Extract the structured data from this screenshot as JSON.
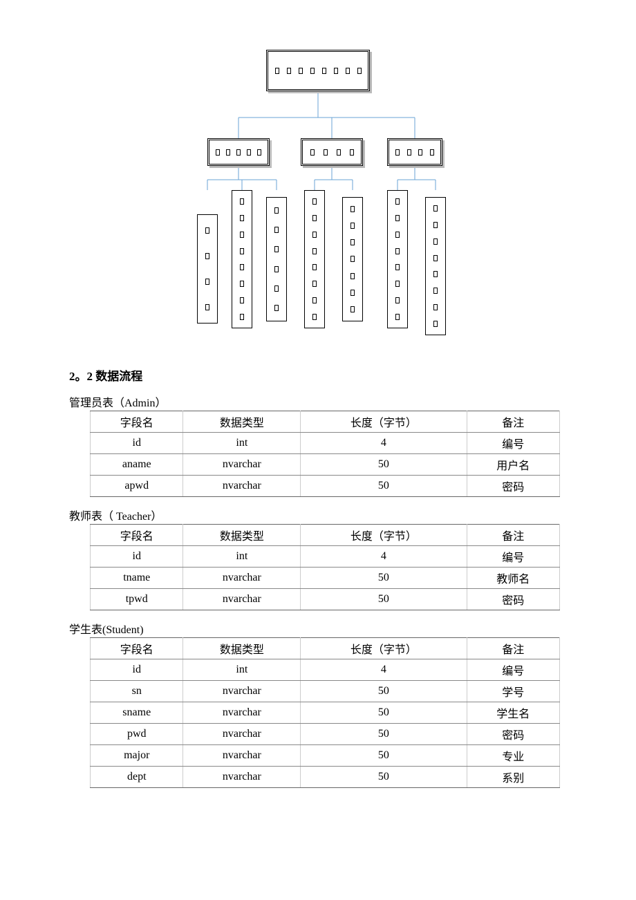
{
  "diagram": {
    "root_glyphs": 8,
    "level2": [
      5,
      4,
      4
    ],
    "level3": [
      4,
      8,
      6,
      8,
      7,
      8,
      8
    ]
  },
  "section_heading": "2。2 数据流程",
  "tables": [
    {
      "title": "管理员表（Admin）",
      "headers": [
        "字段名",
        "数据类型",
        "长度（字节）",
        "备注"
      ],
      "rows": [
        [
          "id",
          "int",
          "4",
          "编号"
        ],
        [
          "aname",
          "nvarchar",
          "50",
          "用户名"
        ],
        [
          "apwd",
          "nvarchar",
          "50",
          "密码"
        ]
      ]
    },
    {
      "title": "教师表（ Teacher）",
      "headers": [
        "字段名",
        "数据类型",
        "长度（字节）",
        "备注"
      ],
      "rows": [
        [
          "id",
          "int",
          "4",
          "编号"
        ],
        [
          "tname",
          "nvarchar",
          "50",
          "教师名"
        ],
        [
          "tpwd",
          "nvarchar",
          "50",
          "密码"
        ]
      ]
    },
    {
      "title": "学生表(Student)",
      "headers": [
        "字段名",
        "数据类型",
        "长度（字节）",
        "备注"
      ],
      "rows": [
        [
          "id",
          "int",
          "4",
          "编号"
        ],
        [
          "sn",
          "nvarchar",
          "50",
          "学号"
        ],
        [
          "sname",
          "nvarchar",
          "50",
          "学生名"
        ],
        [
          "pwd",
          "nvarchar",
          "50",
          "密码"
        ],
        [
          "major",
          "nvarchar",
          "50",
          "专业"
        ],
        [
          "dept",
          "nvarchar",
          "50",
          "系别"
        ]
      ]
    }
  ]
}
